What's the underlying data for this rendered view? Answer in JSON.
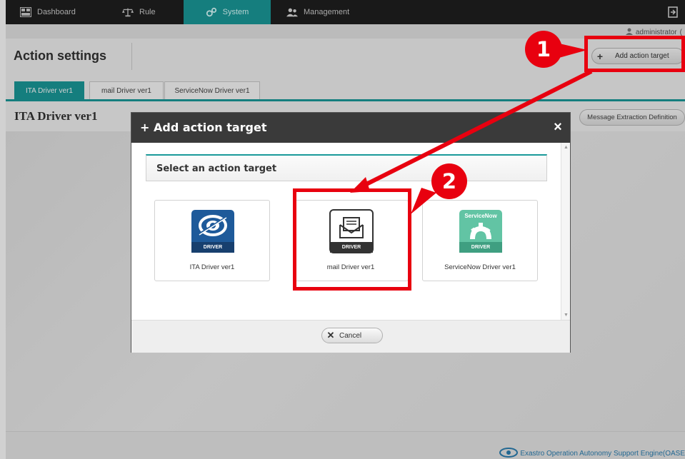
{
  "nav": {
    "items": [
      {
        "label": "Dashboard",
        "icon": "dashboard-icon"
      },
      {
        "label": "Rule",
        "icon": "scales-icon"
      },
      {
        "label": "System",
        "icon": "system-icon",
        "active": true
      },
      {
        "label": "Management",
        "icon": "users-icon"
      }
    ],
    "logout_icon": "logout-icon",
    "active_color": "#1a9a9a"
  },
  "user": {
    "name": "administrator",
    "suffix": "("
  },
  "page": {
    "title": "Action settings",
    "add_button": "Add action target"
  },
  "tabs": [
    "ITA Driver ver1",
    "mail Driver ver1",
    "ServiceNow Driver ver1"
  ],
  "content": {
    "title": "ITA Driver ver1",
    "message_button": "Message Extraction Definition"
  },
  "modal": {
    "title": "+ Add action target",
    "close": "×",
    "select_heading": "Select an action target",
    "cards": [
      {
        "label": "ITA Driver ver1",
        "icon": "ita-driver-icon"
      },
      {
        "label": "mail Driver ver1",
        "icon": "mail-driver-icon"
      },
      {
        "label": "ServiceNow Driver ver1",
        "icon": "servicenow-driver-icon",
        "brand": "ServiceNow"
      }
    ],
    "driver_badge": "DRIVER",
    "cancel": "Cancel"
  },
  "footer": {
    "text": "Exastro Operation Autonomy Support Engine(OASE"
  },
  "annotations": {
    "step1": "1",
    "step2": "2",
    "color": "#e8000f"
  }
}
